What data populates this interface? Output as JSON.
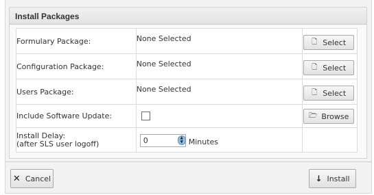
{
  "dialog": {
    "title": "Install Packages",
    "rows": [
      {
        "label": "Formulary Package:",
        "value": "None Selected",
        "button": "Select",
        "button_icon": "document-icon"
      },
      {
        "label": "Configuration Package:",
        "value": "None Selected",
        "button": "Select",
        "button_icon": "document-icon"
      },
      {
        "label": "Users Package:",
        "value": "None Selected",
        "button": "Select",
        "button_icon": "document-icon"
      },
      {
        "label": "Include Software Update:",
        "checked": false,
        "button": "Browse",
        "button_icon": "folder-open-icon"
      },
      {
        "label_line1": "Install Delay:",
        "label_line2": "(after SLS user logoff)",
        "input_value": "0",
        "unit": "Minutes"
      }
    ],
    "footer": {
      "cancel_label": "Cancel",
      "install_label": "Install"
    }
  }
}
